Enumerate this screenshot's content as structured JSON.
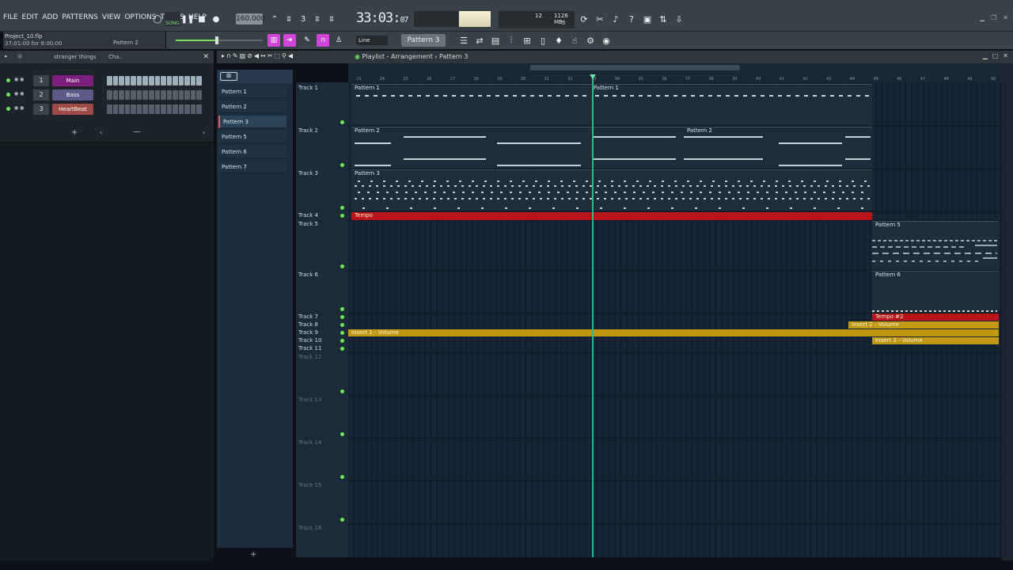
{
  "menu": [
    "FILE",
    "EDIT",
    "ADD",
    "PATTERNS",
    "VIEW",
    "OPTIONS",
    "TOOLS",
    "HELP"
  ],
  "project": {
    "file": "Project_10.flp",
    "time": "37:01:00 for 8:00:00",
    "hint": "Pattern 2"
  },
  "transport": {
    "mode": "SONG",
    "tempo": "160.000",
    "clock_main": "33:03",
    "clock_sub": "07"
  },
  "cpu": {
    "voices": "12",
    "mem": "1126 MB",
    "poly": "5"
  },
  "toolbar2": {
    "snap": "Line",
    "pattern": "Pattern 3"
  },
  "rack": {
    "filter": "stranger things",
    "title": "Cha..",
    "channels": [
      {
        "num": "1",
        "name": "Main",
        "color": "#7d1f7d"
      },
      {
        "num": "2",
        "name": "Bass",
        "color": "#5b5a8a"
      },
      {
        "num": "3",
        "name": "HeartBeat",
        "color": "#a04a4a"
      }
    ]
  },
  "picker": [
    "Pattern 1",
    "Pattern 2",
    "Pattern 3",
    "Pattern 5",
    "Pattern 6",
    "Pattern 7"
  ],
  "playlist": {
    "title": "Playlist - Arrangement",
    "current": "Pattern 3",
    "ruler": [
      "23",
      "24",
      "25",
      "26",
      "27",
      "28",
      "29",
      "30",
      "31",
      "32",
      "33",
      "34",
      "35",
      "36",
      "37",
      "38",
      "39",
      "40",
      "41",
      "42",
      "43",
      "44",
      "45",
      "46",
      "47",
      "48",
      "49",
      "50"
    ],
    "tracks": [
      "Track 1",
      "Track 2",
      "Track 3",
      "Track 4",
      "Track 5",
      "Track 6",
      "Track 7",
      "Track 8",
      "Track 9",
      "Track 10",
      "Track 11",
      "Track 12",
      "Track 13",
      "Track 14",
      "Track 15",
      "Track 16"
    ],
    "clips": {
      "p1a": "Pattern 1",
      "p1b": "Pattern 1",
      "p2a": "Pattern 2",
      "p2b": "Pattern 2",
      "p3": "Pattern 3",
      "tempo": "Tempo",
      "p5": "Pattern 5",
      "p6": "Pattern 6",
      "tempo2": "Tempo #2",
      "ins2": "Insert 2 - Volume",
      "ins1": "Insert 1 - Volume",
      "ins3": "Insert 3 - Volume"
    }
  },
  "colors": {
    "accent": "#d046d8",
    "automation": "#b8141a",
    "volume": "#c09814",
    "playhead": "#2fb88a"
  }
}
